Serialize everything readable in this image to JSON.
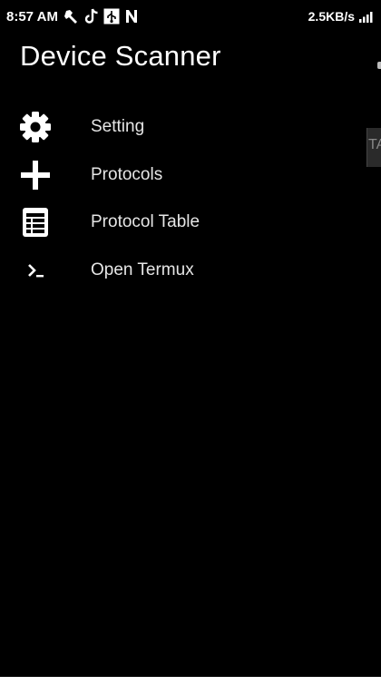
{
  "status_bar": {
    "time": "8:57 AM",
    "speed": "2.5KB/s",
    "icons": [
      "tools-icon",
      "tiktok-icon",
      "usb-icon",
      "n-icon",
      "signal-icon"
    ]
  },
  "app": {
    "title": "Device Scanner"
  },
  "menu": {
    "items": [
      {
        "label": "Setting",
        "icon": "gear-icon"
      },
      {
        "label": "Protocols",
        "icon": "plus-icon"
      },
      {
        "label": "Protocol Table",
        "icon": "table-icon"
      },
      {
        "label": "Open Termux",
        "icon": "terminal-icon"
      }
    ]
  },
  "edge_tab": {
    "text": "TA"
  }
}
